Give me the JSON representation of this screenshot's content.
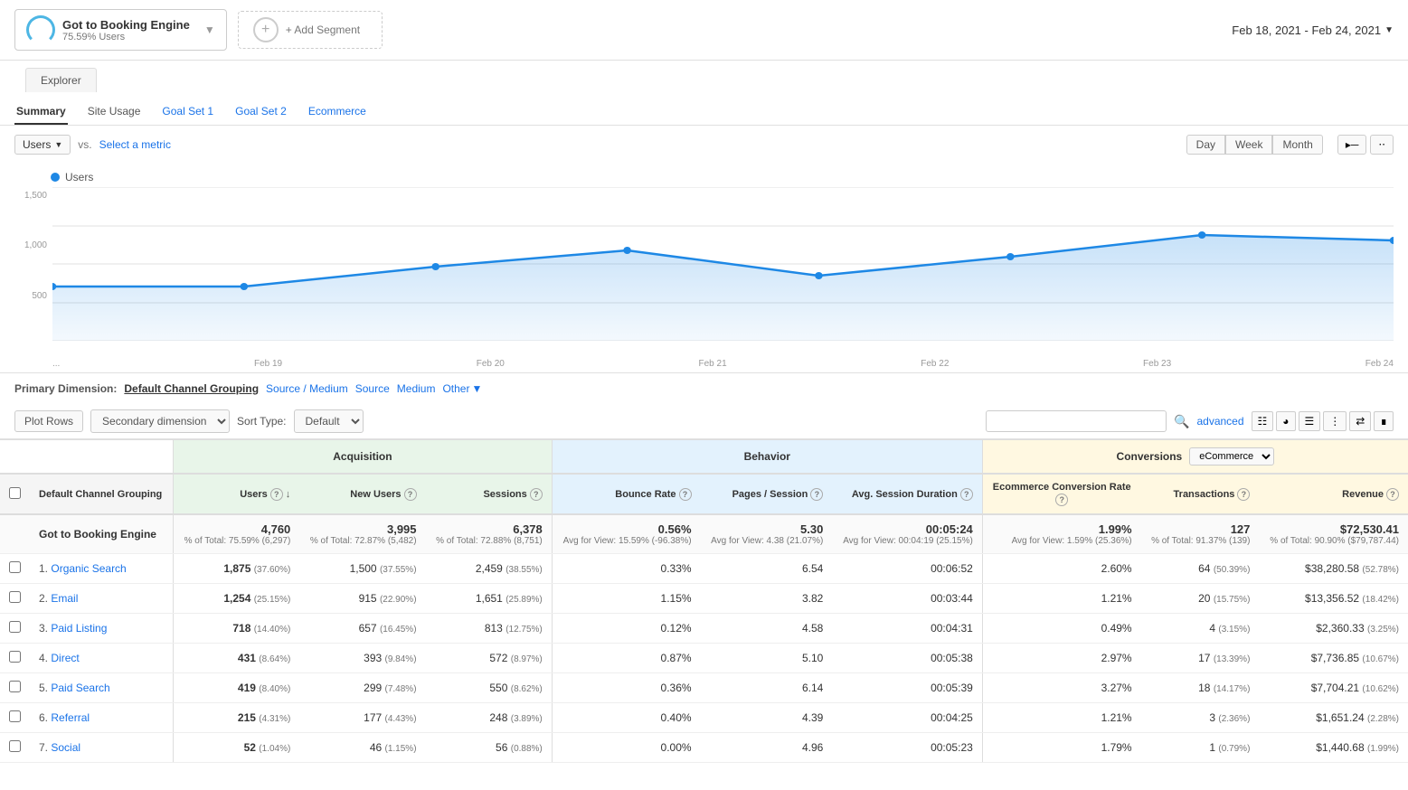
{
  "header": {
    "segment": {
      "title": "Got to Booking Engine",
      "subtitle": "75.59% Users",
      "add_label": "+ Add Segment"
    },
    "date_range": "Feb 18, 2021 - Feb 24, 2021"
  },
  "explorer_tab": "Explorer",
  "tabs": [
    {
      "label": "Summary",
      "active": true
    },
    {
      "label": "Site Usage",
      "active": false
    },
    {
      "label": "Goal Set 1",
      "active": false
    },
    {
      "label": "Goal Set 2",
      "active": false
    },
    {
      "label": "Ecommerce",
      "active": false
    }
  ],
  "metric_row": {
    "metric": "Users",
    "vs_text": "vs.",
    "select_metric": "Select a metric",
    "time_buttons": [
      "Day",
      "Week",
      "Month"
    ]
  },
  "chart": {
    "legend_label": "Users",
    "y_labels": [
      "1,500",
      "1,000",
      "500"
    ],
    "x_labels": [
      "...",
      "Feb 19",
      "Feb 20",
      "Feb 21",
      "Feb 22",
      "Feb 23",
      "Feb 24"
    ]
  },
  "dimension_bar": {
    "label": "Primary Dimension:",
    "options": [
      {
        "label": "Default Channel Grouping",
        "active": true
      },
      {
        "label": "Source / Medium",
        "active": false
      },
      {
        "label": "Source",
        "active": false
      },
      {
        "label": "Medium",
        "active": false
      },
      {
        "label": "Other",
        "active": false
      }
    ]
  },
  "table_controls": {
    "plot_rows": "Plot Rows",
    "secondary_dim": "Secondary dimension",
    "sort_type_label": "Sort Type:",
    "sort_default": "Default",
    "advanced": "advanced",
    "search_placeholder": ""
  },
  "table": {
    "header_groups": [
      {
        "label": "Acquisition",
        "colspan": 3
      },
      {
        "label": "Behavior",
        "colspan": 4
      },
      {
        "label": "Conversions",
        "colspan": 3
      }
    ],
    "columns": [
      {
        "label": "Default Channel Grouping",
        "align": "left"
      },
      {
        "label": "Users",
        "sortable": true
      },
      {
        "label": "New Users"
      },
      {
        "label": "Sessions"
      },
      {
        "label": "Bounce Rate"
      },
      {
        "label": "Pages / Session"
      },
      {
        "label": "Avg. Session Duration"
      },
      {
        "label": "Ecommerce Conversion Rate"
      },
      {
        "label": "Transactions"
      },
      {
        "label": "Revenue"
      }
    ],
    "total_row": {
      "label": "Got to Booking Engine",
      "users": "4,760",
      "users_sub": "% of Total: 75.59% (6,297)",
      "new_users": "3,995",
      "new_users_sub": "% of Total: 72.87% (5,482)",
      "sessions": "6,378",
      "sessions_sub": "% of Total: 72.88% (8,751)",
      "bounce_rate": "0.56%",
      "bounce_rate_sub": "Avg for View: 15.59% (-96.38%)",
      "pages_session": "5.30",
      "pages_session_sub": "Avg for View: 4.38 (21.07%)",
      "avg_session": "00:05:24",
      "avg_session_sub": "Avg for View: 00:04:19 (25.15%)",
      "ecom_conv": "1.99%",
      "ecom_conv_sub": "Avg for View: 1.59% (25.36%)",
      "transactions": "127",
      "transactions_sub": "% of Total: 91.37% (139)",
      "revenue": "$72,530.41",
      "revenue_sub": "% of Total: 90.90% ($79,787.44)"
    },
    "rows": [
      {
        "num": "1.",
        "label": "Organic Search",
        "users": "1,875",
        "users_pct": "(37.60%)",
        "new_users": "1,500",
        "new_users_pct": "(37.55%)",
        "sessions": "2,459",
        "sessions_pct": "(38.55%)",
        "bounce_rate": "0.33%",
        "pages_session": "6.54",
        "avg_session": "00:06:52",
        "ecom_conv": "2.60%",
        "transactions": "64",
        "transactions_pct": "(50.39%)",
        "revenue": "$38,280.58",
        "revenue_pct": "(52.78%)"
      },
      {
        "num": "2.",
        "label": "Email",
        "users": "1,254",
        "users_pct": "(25.15%)",
        "new_users": "915",
        "new_users_pct": "(22.90%)",
        "sessions": "1,651",
        "sessions_pct": "(25.89%)",
        "bounce_rate": "1.15%",
        "pages_session": "3.82",
        "avg_session": "00:03:44",
        "ecom_conv": "1.21%",
        "transactions": "20",
        "transactions_pct": "(15.75%)",
        "revenue": "$13,356.52",
        "revenue_pct": "(18.42%)"
      },
      {
        "num": "3.",
        "label": "Paid Listing",
        "users": "718",
        "users_pct": "(14.40%)",
        "new_users": "657",
        "new_users_pct": "(16.45%)",
        "sessions": "813",
        "sessions_pct": "(12.75%)",
        "bounce_rate": "0.12%",
        "pages_session": "4.58",
        "avg_session": "00:04:31",
        "ecom_conv": "0.49%",
        "transactions": "4",
        "transactions_pct": "(3.15%)",
        "revenue": "$2,360.33",
        "revenue_pct": "(3.25%)"
      },
      {
        "num": "4.",
        "label": "Direct",
        "users": "431",
        "users_pct": "(8.64%)",
        "new_users": "393",
        "new_users_pct": "(9.84%)",
        "sessions": "572",
        "sessions_pct": "(8.97%)",
        "bounce_rate": "0.87%",
        "pages_session": "5.10",
        "avg_session": "00:05:38",
        "ecom_conv": "2.97%",
        "transactions": "17",
        "transactions_pct": "(13.39%)",
        "revenue": "$7,736.85",
        "revenue_pct": "(10.67%)"
      },
      {
        "num": "5.",
        "label": "Paid Search",
        "users": "419",
        "users_pct": "(8.40%)",
        "new_users": "299",
        "new_users_pct": "(7.48%)",
        "sessions": "550",
        "sessions_pct": "(8.62%)",
        "bounce_rate": "0.36%",
        "pages_session": "6.14",
        "avg_session": "00:05:39",
        "ecom_conv": "3.27%",
        "transactions": "18",
        "transactions_pct": "(14.17%)",
        "revenue": "$7,704.21",
        "revenue_pct": "(10.62%)"
      },
      {
        "num": "6.",
        "label": "Referral",
        "users": "215",
        "users_pct": "(4.31%)",
        "new_users": "177",
        "new_users_pct": "(4.43%)",
        "sessions": "248",
        "sessions_pct": "(3.89%)",
        "bounce_rate": "0.40%",
        "pages_session": "4.39",
        "avg_session": "00:04:25",
        "ecom_conv": "1.21%",
        "transactions": "3",
        "transactions_pct": "(2.36%)",
        "revenue": "$1,651.24",
        "revenue_pct": "(2.28%)"
      },
      {
        "num": "7.",
        "label": "Social",
        "users": "52",
        "users_pct": "(1.04%)",
        "new_users": "46",
        "new_users_pct": "(1.15%)",
        "sessions": "56",
        "sessions_pct": "(0.88%)",
        "bounce_rate": "0.00%",
        "pages_session": "4.96",
        "avg_session": "00:05:23",
        "ecom_conv": "1.79%",
        "transactions": "1",
        "transactions_pct": "(0.79%)",
        "revenue": "$1,440.68",
        "revenue_pct": "(1.99%)"
      }
    ]
  }
}
